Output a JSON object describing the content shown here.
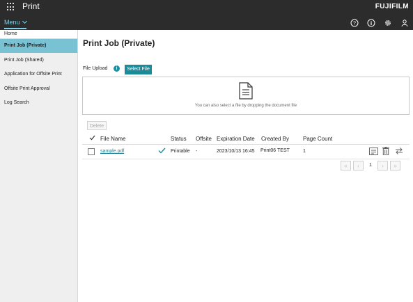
{
  "header": {
    "app_title": "Print",
    "brand": "FUJIFILM",
    "menu_label": "Menu",
    "icons": [
      "help-icon",
      "info-icon",
      "gear-icon",
      "user-icon"
    ]
  },
  "sidebar": {
    "breadcrumb": "Home",
    "items": [
      {
        "label": "Print Job (Private)",
        "active": true
      },
      {
        "label": "Print Job (Shared)",
        "active": false
      },
      {
        "label": "Application for Offsite Print",
        "active": false
      },
      {
        "label": "Offsite Print Approval",
        "active": false
      },
      {
        "label": "Log Search",
        "active": false
      }
    ]
  },
  "main": {
    "title": "Print Job (Private)",
    "upload_label": "File Upload",
    "select_file_label": "Select File",
    "drop_hint": "You can also select a file by dropping the document file",
    "delete_label": "Delete",
    "table": {
      "headers": [
        "File Name",
        "Status",
        "Offsite",
        "Expiration Date",
        "Created By",
        "Page Count"
      ],
      "rows": [
        {
          "file_name": "sample.pdf",
          "status": "Printable",
          "offsite": "-",
          "expiration": "2023/10/13 16:45",
          "created_by": "Print06 TEST",
          "page_count": "1"
        }
      ]
    },
    "pagination": {
      "current_page": "1"
    }
  },
  "colors": {
    "topbar": "#2c2c2c",
    "accent": "#1c8a99",
    "nav_active": "#79c2d4",
    "menu_text": "#7fd0e6"
  }
}
